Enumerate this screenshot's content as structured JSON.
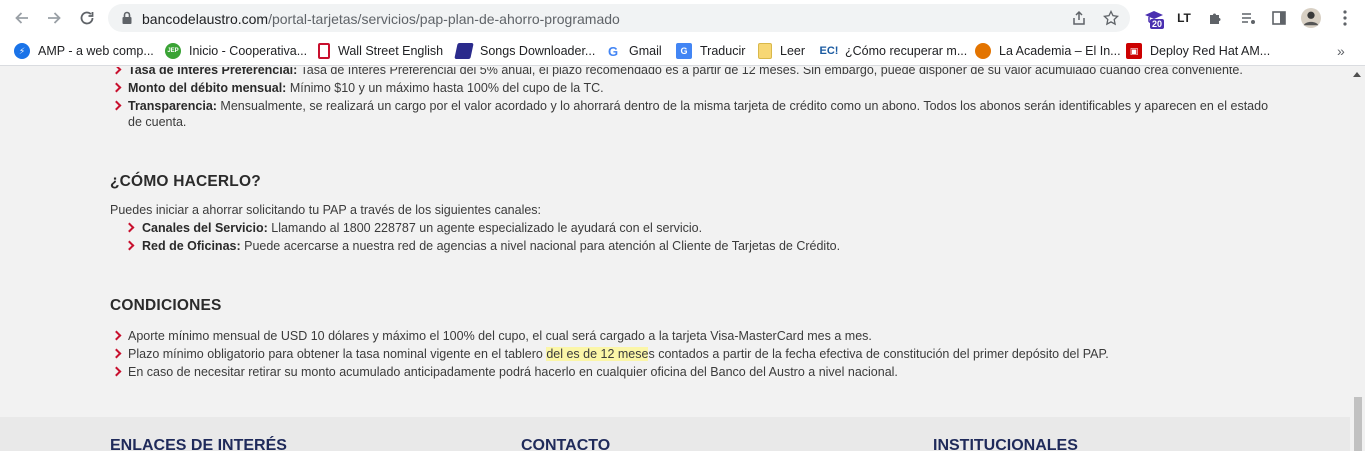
{
  "browser": {
    "url_host": "bancodelaustro.com",
    "url_path": "/portal-tarjetas/servicios/pap-plan-de-ahorro-programado",
    "extension_badge": "20",
    "bookmarks": [
      {
        "label": "AMP - a web comp...",
        "icon": "amp-icon",
        "color": "#1a73e8"
      },
      {
        "label": "Inicio - Cooperativa...",
        "icon": "jep-icon",
        "color": "#3aa335"
      },
      {
        "label": "Wall Street English",
        "icon": "wse-icon",
        "color": "#c8102e"
      },
      {
        "label": "Songs Downloader...",
        "icon": "songs-icon",
        "color": "#2b2b8c"
      },
      {
        "label": "Gmail",
        "icon": "google-icon",
        "color": "#4285f4"
      },
      {
        "label": "Traducir",
        "icon": "translate-icon",
        "color": "#4285f4"
      },
      {
        "label": "Leer",
        "icon": "folder-icon",
        "color": "#f7d774"
      },
      {
        "label": "¿Cómo recuperar m...",
        "icon": "ec-icon",
        "color": "#1a5aa0"
      },
      {
        "label": "La Academia – El In...",
        "icon": "academia-icon",
        "color": "#e37400"
      },
      {
        "label": "Deploy Red Hat AM...",
        "icon": "redhat-icon",
        "color": "#cc0000"
      }
    ]
  },
  "content": {
    "benefits": [
      {
        "bold": "Tasa de Interés Preferencial:",
        "text": " Tasa de Interés Preferencial del 5% anual, el plazo recomendado es a partir de 12 meses. Sin embargo, puede disponer de su valor acumulado cuando crea conveniente."
      },
      {
        "bold": "Monto del débito mensual:",
        "text": " Mínimo $10 y un máximo hasta 100% del cupo de la TC."
      },
      {
        "bold": "Transparencia:",
        "text": " Mensualmente, se realizará un cargo por el valor acordado y lo ahorrará dentro de la misma tarjeta de crédito como un abono. Todos los abonos serán identificables y aparecen en el estado",
        "text2": "de cuenta."
      }
    ],
    "how_title": "¿CÓMO HACERLO?",
    "how_intro": "Puedes iniciar a ahorrar solicitando tu PAP a través de los siguientes canales:",
    "channels": [
      {
        "bold": "Canales del Servicio:",
        "text": "  Llamando al 1800 228787 un agente especializado le ayudará con el servicio."
      },
      {
        "bold": "Red de Oficinas:",
        "text": " Puede acercarse a nuestra red de agencias a nivel nacional para atención al Cliente de Tarjetas de Crédito."
      }
    ],
    "conditions_title": "CONDICIONES",
    "conditions": {
      "c1": "Aporte mínimo mensual de USD 10 dólares y máximo el 100% del cupo, el cual será cargado a la tarjeta Visa-MasterCard mes a mes.",
      "c2_pre": "Plazo mínimo obligatorio para obtener la tasa nominal vigente en el tablero ",
      "c2_hl": "del es de 12 mese",
      "c2_post": "s contados a partir de la fecha efectiva de constitución del primer depósito del PAP.",
      "c3": "En caso de necesitar retirar su monto acumulado anticipadamente podrá hacerlo en cualquier oficina del Banco del Austro a nivel nacional."
    },
    "footer": {
      "links_title": "ENLACES DE INTERÉS",
      "contact_title": "CONTACTO",
      "institutional_title": "INSTITUCIONALES"
    }
  }
}
